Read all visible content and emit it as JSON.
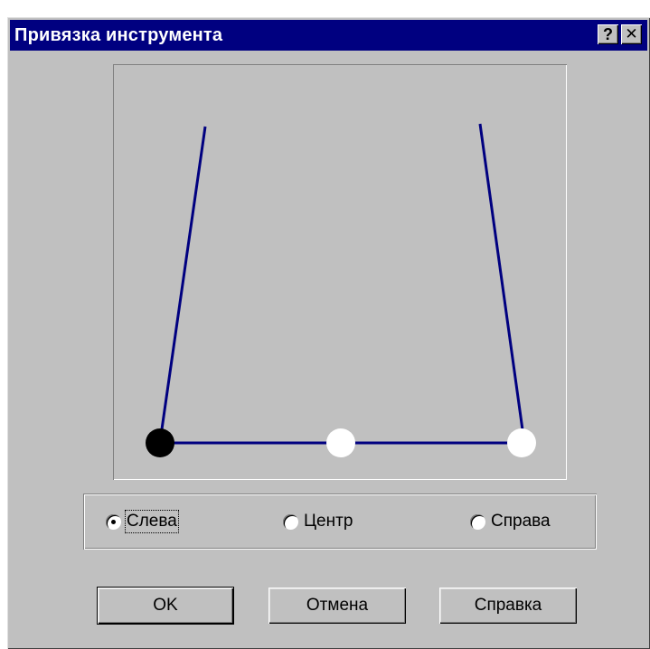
{
  "window": {
    "title": "Привязка инструмента",
    "help_button_label": "?",
    "close_button_label": "✕"
  },
  "preview": {
    "colors": {
      "line": "#000080",
      "active_point": "#000000",
      "inactive_point": "#ffffff"
    }
  },
  "alignment": {
    "options": [
      {
        "label": "Слева",
        "selected": true
      },
      {
        "label": "Центр",
        "selected": false
      },
      {
        "label": "Справа",
        "selected": false
      }
    ]
  },
  "buttons": {
    "ok_label": "OK",
    "cancel_label": "Отмена",
    "help_label": "Справка"
  }
}
